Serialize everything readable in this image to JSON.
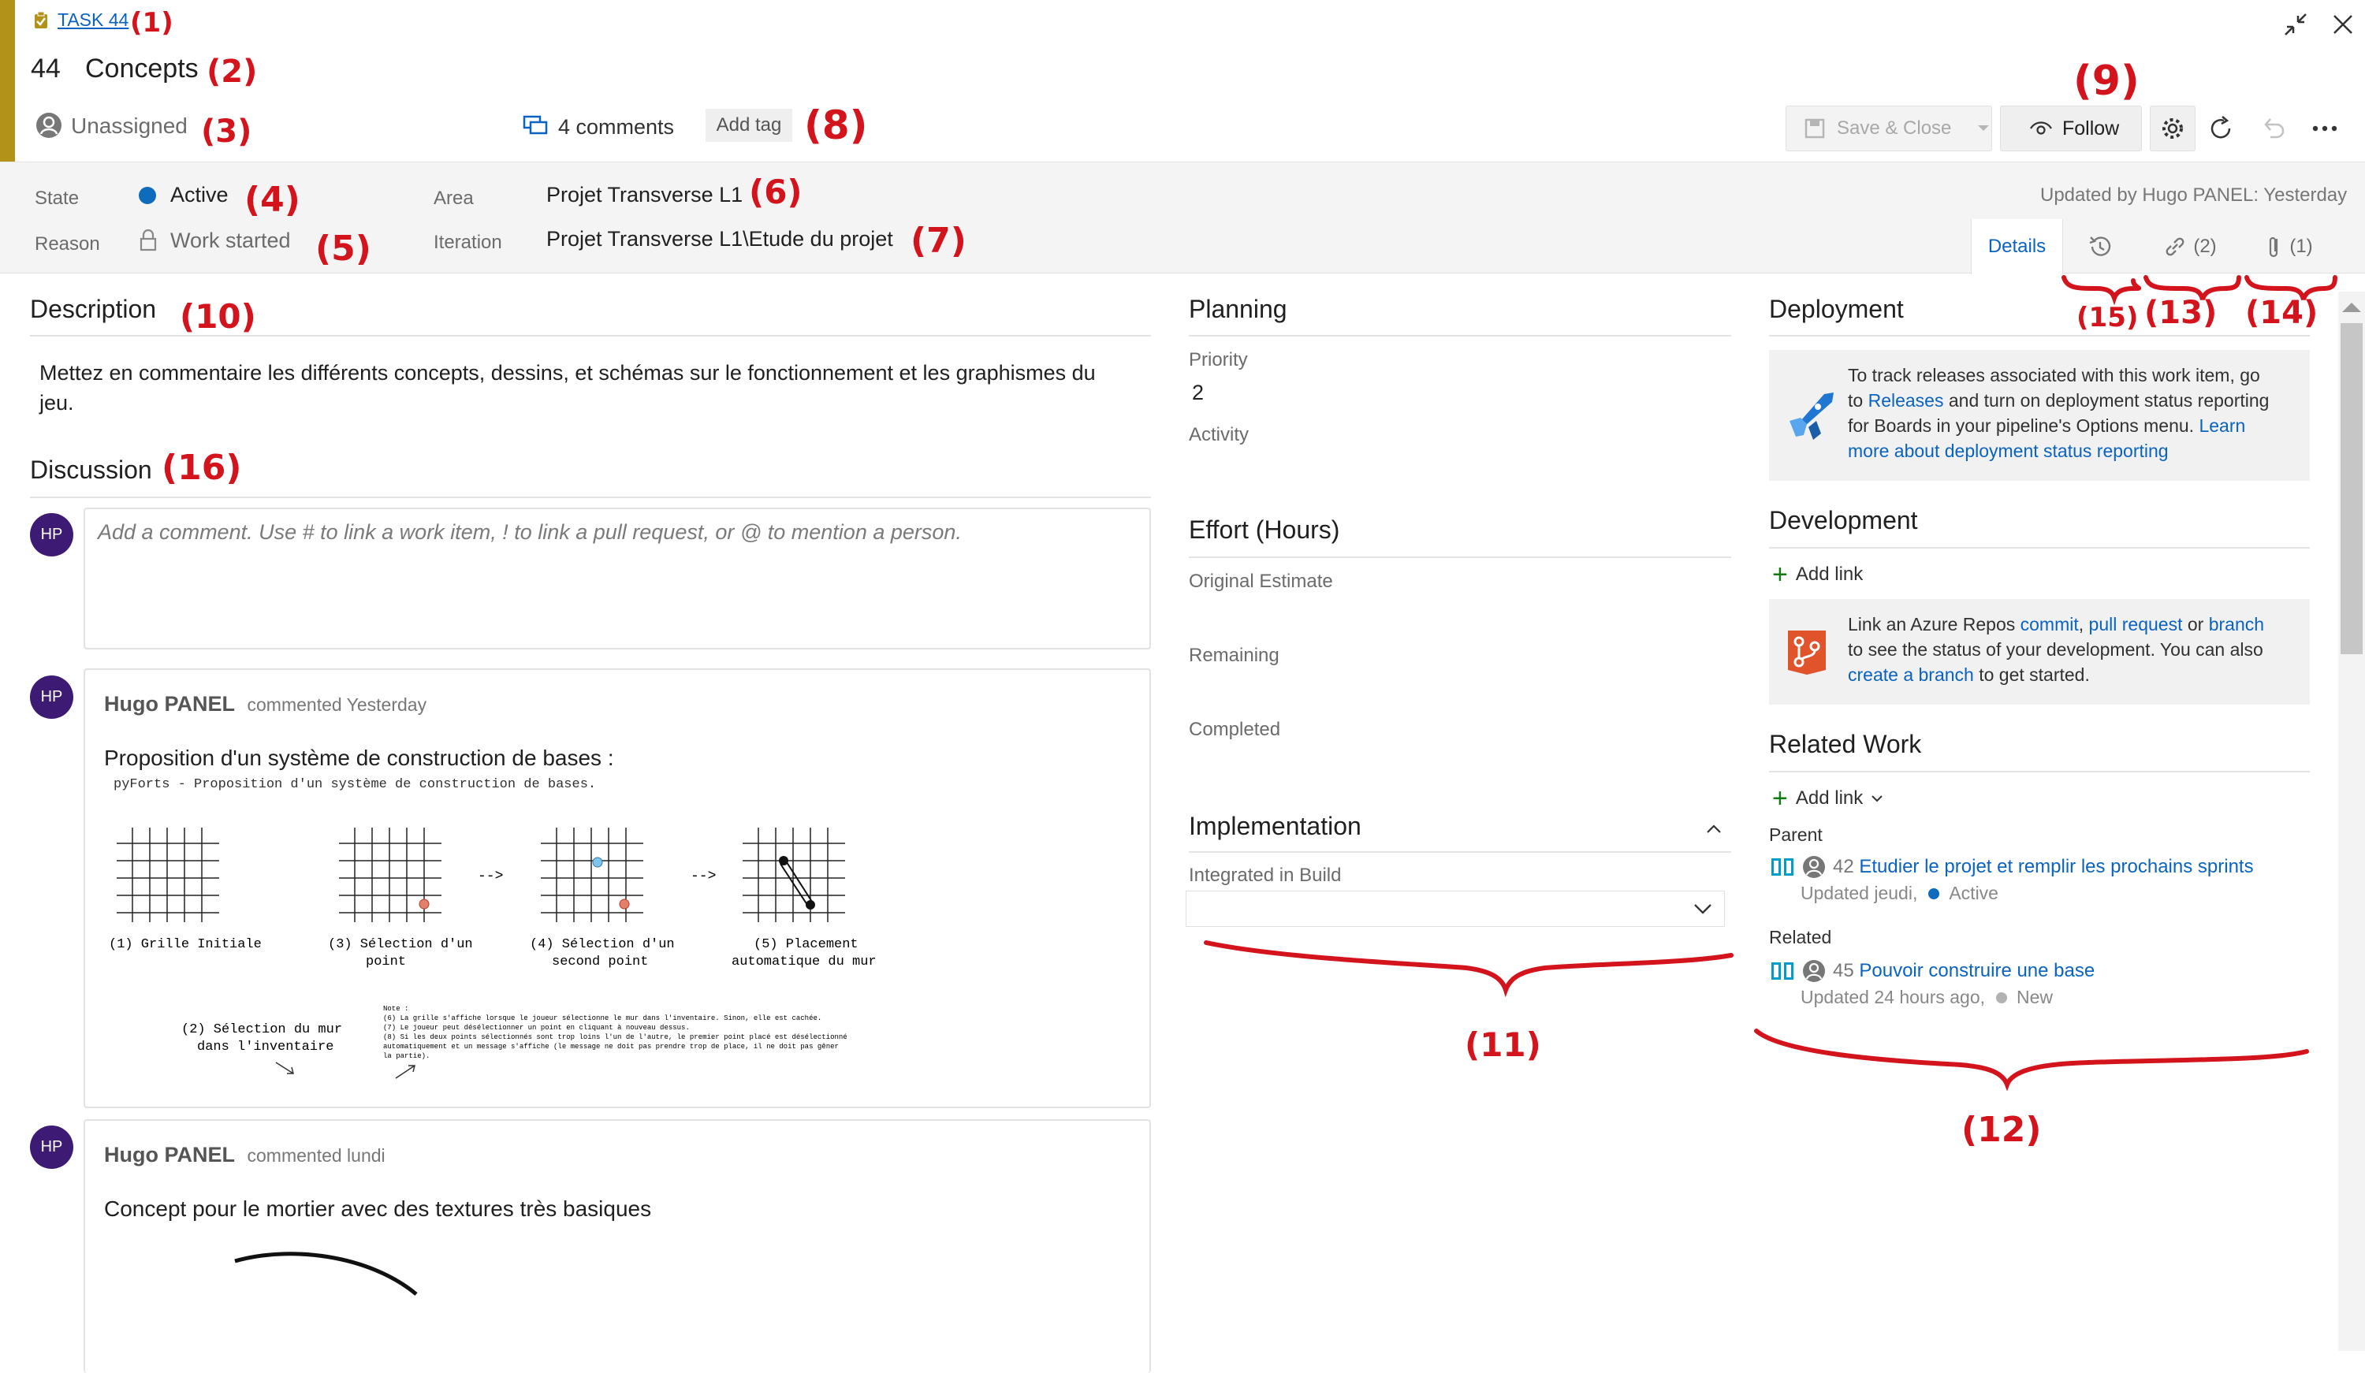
{
  "header": {
    "task_link": "TASK 44",
    "id": "44",
    "title": "Concepts",
    "assignee": "Unassigned",
    "comments": "4 comments",
    "add_tag": "Add tag",
    "save_close": "Save & Close",
    "follow": "Follow",
    "updated_by": "Updated by Hugo PANEL: Yesterday"
  },
  "fields": {
    "state_label": "State",
    "state_value": "Active",
    "reason_label": "Reason",
    "reason_value": "Work started",
    "area_label": "Area",
    "area_value": "Projet Transverse L1",
    "iteration_label": "Iteration",
    "iteration_value": "Projet Transverse L1\\Etude du projet"
  },
  "tabs": {
    "details": "Details",
    "links_count": "(2)",
    "attachments_count": "(1)"
  },
  "description": {
    "title": "Description",
    "line1": "Mettez en commentaire les différents concepts, dessins, et schémas sur le fonctionnement et les graphismes du",
    "line2": "jeu."
  },
  "discussion": {
    "title": "Discussion",
    "placeholder": "Add a comment. Use # to link a work item, ! to link a pull request, or @ to mention a person.",
    "my_initials": "HP",
    "comments": [
      {
        "initials": "HP",
        "author": "Hugo PANEL",
        "when": "commented Yesterday",
        "text": "Proposition d'un système de construction de bases :",
        "sketch": {
          "title": "pyForts - Proposition d'un système de construction de bases.",
          "step1": "(1) Grille Initiale",
          "step3a": "(3) Sélection d'un",
          "step3b": "point",
          "step4a": "(4) Sélection d'un",
          "step4b": "second point",
          "step5a": "(5) Placement",
          "step5b": "automatique du mur",
          "step2a": "(2) Sélection du mur",
          "step2b": "dans l'inventaire",
          "arrow": "-->",
          "note_title": "Note :",
          "note1": "(6) La grille s'affiche lorsque le joueur sélectionne le mur dans l'inventaire. Sinon, elle est cachée.",
          "note2": "(7) Le joueur peut désélectionner un point en cliquant à nouveau dessus.",
          "note3": "(8) Si les deux points sélectionnés sont trop loins l'un de l'autre, le premier point placé est désélectionné",
          "note4": "automatiquement et un message s'affiche (le message ne doit pas prendre trop de place, il ne doit pas gêner",
          "note5": "la partie)."
        }
      },
      {
        "initials": "HP",
        "author": "Hugo PANEL",
        "when": "commented lundi",
        "text": "Concept pour le mortier avec des textures très basiques"
      }
    ]
  },
  "planning": {
    "title": "Planning",
    "priority_label": "Priority",
    "priority_value": "2",
    "activity_label": "Activity"
  },
  "effort": {
    "title": "Effort (Hours)",
    "original": "Original Estimate",
    "remaining": "Remaining",
    "completed": "Completed"
  },
  "implementation": {
    "title": "Implementation",
    "build_label": "Integrated in Build"
  },
  "deployment": {
    "title": "Deployment",
    "l1": "To track releases associated with this work item, go",
    "l2a": "to ",
    "l2link": "Releases",
    "l2b": " and turn on deployment status reporting",
    "l3a": "for Boards in your pipeline's Options menu. ",
    "l3link": "Learn",
    "l4link": "more about deployment status reporting"
  },
  "development": {
    "title": "Development",
    "add_link": "Add link",
    "l1a": "Link an Azure Repos ",
    "l1link1": "commit",
    "l1sep": ", ",
    "l1link2": "pull request",
    "l1b": " or ",
    "l1link3": "branch",
    "l2": "to see the status of your development. You can also",
    "l3link": "create a branch",
    "l3b": " to get started."
  },
  "related_work": {
    "title": "Related Work",
    "add_link": "Add link",
    "parent_label": "Parent",
    "parent_id": "42",
    "parent_title": "Etudier le projet et remplir les prochains sprints",
    "parent_updated": "Updated jeudi,",
    "parent_state": "Active",
    "related_label": "Related",
    "related_id": "45",
    "related_title": "Pouvoir construire une base",
    "related_updated": "Updated 24 hours ago,",
    "related_state": "New"
  },
  "annotations": [
    "(1)",
    "(2)",
    "(3)",
    "(4)",
    "(5)",
    "(6)",
    "(7)",
    "(8)",
    "(9)",
    "(10)",
    "(11)",
    "(12)",
    "(13)",
    "(14)",
    "(15)",
    "(16)"
  ],
  "colors": {
    "accent": "#b3921a",
    "link": "#0a63c0",
    "state_active": "#0f6cbd",
    "state_new": "#b2b2b2",
    "avatar": "#3d1a73",
    "annotation_red": "#d4141c"
  }
}
